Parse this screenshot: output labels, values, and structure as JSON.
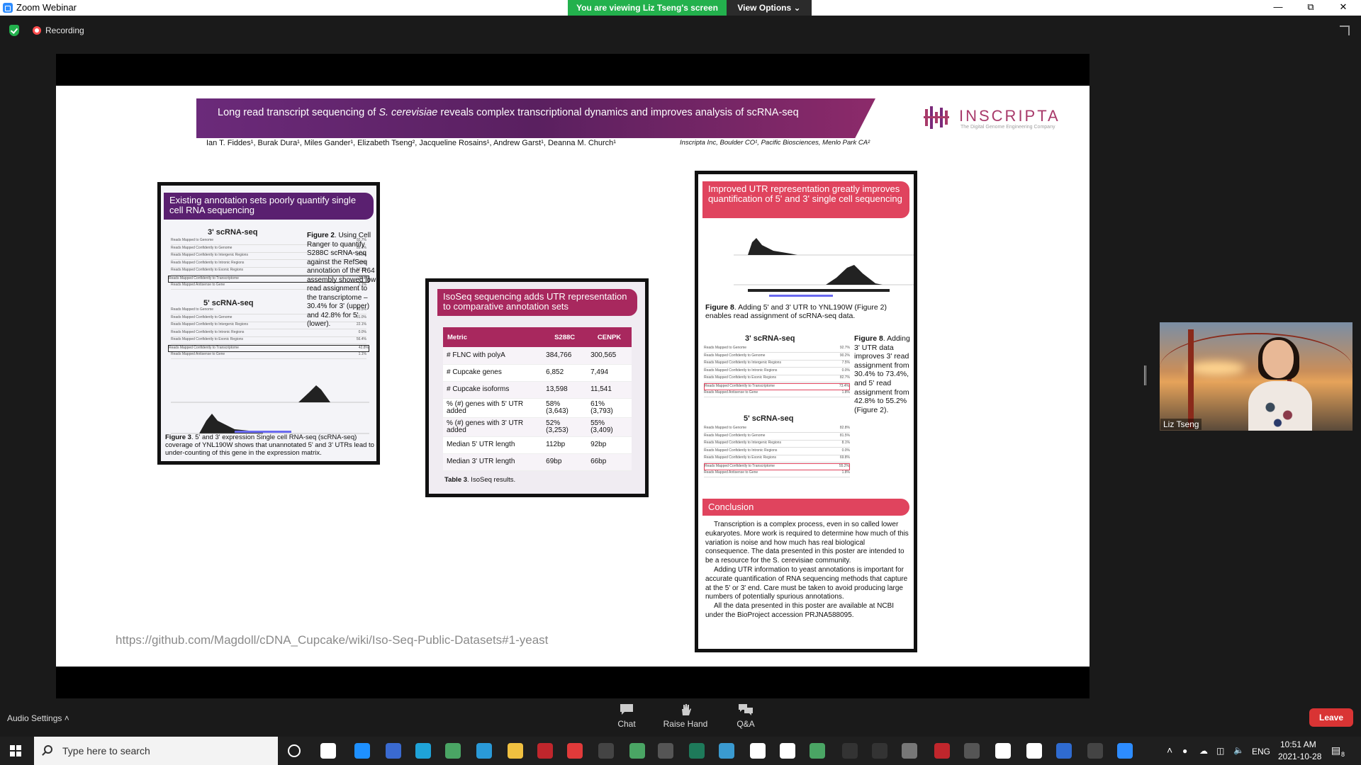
{
  "window": {
    "title": "Zoom Webinar",
    "share_banner": "You are viewing Liz Tseng's screen",
    "view_options": "View Options",
    "recording": "Recording"
  },
  "slide": {
    "title_pre": "Long read transcript sequencing of ",
    "title_species": "S. cerevisiae",
    "title_post": " reveals complex transcriptional dynamics and improves analysis of scRNA-seq",
    "authors": "Ian T. Fiddes¹, Burak Dura¹, Miles Gander¹, Elizabeth Tseng², Jacqueline Rosains¹, Andrew Garst¹, Deanna M. Church¹",
    "affiliations": "Inscripta Inc, Boulder CO¹, Pacific Biosciences, Menlo Park CA²",
    "logo_text": "INSCRIPTA",
    "logo_tagline": "The Digital Genome Engineering Company",
    "url": "https://github.com/Magdoll/cDNA_Cupcake/wiki/Iso-Seq-Public-Datasets#1-yeast",
    "panel1": {
      "heading": "Existing annotation sets poorly quantify single cell RNA sequencing",
      "sub3": "3' scRNA-seq",
      "sub5": "5' scRNA-seq",
      "rows3": [
        {
          "label": "Reads Mapped to Genome",
          "value": "92.7%"
        },
        {
          "label": "Reads Mapped Confidently to Genome",
          "value": "88.1%"
        },
        {
          "label": "Reads Mapped Confidently to Intergenic Regions",
          "value": "29.8%"
        },
        {
          "label": "Reads Mapped Confidently to Intronic Regions",
          "value": "0.0%"
        },
        {
          "label": "Reads Mapped Confidently to Exonic Regions",
          "value": "57.3%"
        },
        {
          "label": "Reads Mapped Confidently to Transcriptome",
          "value": "30.4%"
        },
        {
          "label": "Reads Mapped Antisense to Gene",
          "value": "1.1%"
        }
      ],
      "rows5": [
        {
          "label": "Reads Mapped to Genome",
          "value": "89.5%"
        },
        {
          "label": "Reads Mapped Confidently to Genome",
          "value": "81.0%"
        },
        {
          "label": "Reads Mapped Confidently to Intergenic Regions",
          "value": "22.1%"
        },
        {
          "label": "Reads Mapped Confidently to Intronic Regions",
          "value": "0.0%"
        },
        {
          "label": "Reads Mapped Confidently to Exonic Regions",
          "value": "56.4%"
        },
        {
          "label": "Reads Mapped Confidently to Transcriptome",
          "value": "42.8%"
        },
        {
          "label": "Reads Mapped Antisense to Gene",
          "value": "1.1%"
        }
      ],
      "fig2_label": "Figure 2",
      "fig2_text": ". Using Cell Ranger to quantify S288C scRNA-seq against the RefSeq annotation of the R64 assembly showed low read assignment to the transcriptome – 30.4% for 3' (upper) and 42.8% for 5' (lower).",
      "fig3_label": "Figure 3",
      "fig3_text": ". 5' and 3' expression Single cell RNA-seq (scRNA-seq) coverage of YNL190W shows that unannotated 5' and 3' UTRs lead to under-counting of this gene in the expression matrix."
    },
    "panel2": {
      "heading": "IsoSeq sequencing adds UTR representation to comparative annotation sets",
      "headers": [
        "Metric",
        "S288C",
        "CENPK"
      ],
      "rows": [
        [
          "# FLNC with polyA",
          "384,766",
          "300,565"
        ],
        [
          "# Cupcake genes",
          "6,852",
          "7,494"
        ],
        [
          "# Cupcake isoforms",
          "13,598",
          "11,541"
        ],
        [
          "% (#) genes with 5' UTR added",
          "58% (3,643)",
          "61% (3,793)"
        ],
        [
          "% (#) genes with 3' UTR added",
          "52% (3,253)",
          "55% (3,409)"
        ],
        [
          "Median 5' UTR length",
          "112bp",
          "92bp"
        ],
        [
          "Median 3' UTR length",
          "69bp",
          "66bp"
        ]
      ],
      "caption_label": "Table 3",
      "caption_text": ". IsoSeq results."
    },
    "panel3": {
      "heading": "Improved UTR representation greatly improves quantification of 5' and 3' single cell sequencing",
      "fig8a_label": "Figure 8",
      "fig8a_text": ". Adding 5' and 3' UTR to YNL190W (Figure 2) enables read assignment of scRNA-seq data.",
      "sub3": "3' scRNA-seq",
      "sub5": "5' scRNA-seq",
      "rows3": [
        {
          "label": "Reads Mapped to Genome",
          "value": "92.7%"
        },
        {
          "label": "Reads Mapped Confidently to Genome",
          "value": "90.2%"
        },
        {
          "label": "Reads Mapped Confidently to Intergenic Regions",
          "value": "7.5%"
        },
        {
          "label": "Reads Mapped Confidently to Intronic Regions",
          "value": "0.0%"
        },
        {
          "label": "Reads Mapped Confidently to Exonic Regions",
          "value": "82.7%"
        },
        {
          "label": "Reads Mapped Confidently to Transcriptome",
          "value": "73.4%"
        },
        {
          "label": "Reads Mapped Antisense to Gene",
          "value": "1.8%"
        }
      ],
      "rows5": [
        {
          "label": "Reads Mapped to Genome",
          "value": "82.8%"
        },
        {
          "label": "Reads Mapped Confidently to Genome",
          "value": "81.5%"
        },
        {
          "label": "Reads Mapped Confidently to Intergenic Regions",
          "value": "8.1%"
        },
        {
          "label": "Reads Mapped Confidently to Intronic Regions",
          "value": "0.0%"
        },
        {
          "label": "Reads Mapped Confidently to Exonic Regions",
          "value": "69.8%"
        },
        {
          "label": "Reads Mapped Confidently to Transcriptome",
          "value": "55.2%"
        },
        {
          "label": "Reads Mapped Antisense to Gene",
          "value": "1.8%"
        }
      ],
      "fig8b_label": "Figure 8",
      "fig8b_text": ". Adding 3' UTR data improves 3' read assignment from 30.4% to 73.4%, and 5' read assignment from 42.8% to 55.2% (Figure 2).",
      "conclusion_heading": "Conclusion",
      "conclusion_p1": "Transcription is a complex process, even in so called lower eukaryotes. More work is required to determine how much of this variation is noise and how much has real biological consequence. The data presented in this poster are intended to be a resource for the S. cerevisiae community.",
      "conclusion_p2": "Adding UTR information to yeast annotations is important for accurate quantification of RNA sequencing methods that capture at the 5' or 3' end. Care must be taken to avoid producing large numbers of potentially spurious annotations.",
      "conclusion_p3": "All the data presented in this poster are available at NCBI under the BioProject accession PRJNA588095."
    }
  },
  "video": {
    "name": "Liz Tseng"
  },
  "toolbar": {
    "audio_settings": "Audio Settings",
    "chat": "Chat",
    "raise_hand": "Raise Hand",
    "qa": "Q&A",
    "leave": "Leave"
  },
  "taskbar": {
    "search_placeholder": "Type here to search",
    "lang": "ENG",
    "time": "10:51 AM",
    "date": "2021-10-28",
    "notification_count": "8"
  },
  "colors": {
    "zoom_blue": "#2d8cff",
    "share_green": "#23b14d",
    "leave_red": "#d93434",
    "poster_magenta": "#a8285e",
    "poster_red": "#e0445e",
    "poster_purple": "#5a2060"
  }
}
